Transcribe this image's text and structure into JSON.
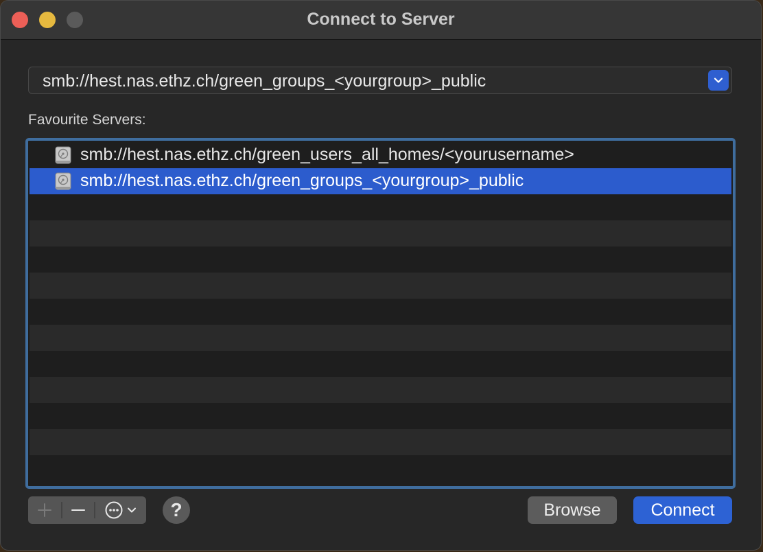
{
  "window": {
    "title": "Connect to Server"
  },
  "traffic_lights": {
    "close_color": "#ec5f57",
    "minimize_color": "#e6b93f",
    "zoom_color": "#5a5a5a"
  },
  "address": {
    "value": "smb://hest.nas.ethz.ch/green_groups_<yourgroup>_public",
    "toggle_icon": "chevron-down-icon"
  },
  "favourites": {
    "label": "Favourite Servers:",
    "items": [
      {
        "text": "smb://hest.nas.ethz.ch/green_users_all_homes/<yourusername>",
        "icon": "server-drive-icon",
        "selected": false
      },
      {
        "text": "smb://hest.nas.ethz.ch/green_groups_<yourgroup>_public",
        "icon": "server-drive-icon",
        "selected": true
      }
    ]
  },
  "toolbar": {
    "add_icon": "plus-icon",
    "remove_icon": "minus-icon",
    "more_icon": "ellipsis-circle-icon",
    "help_label": "?"
  },
  "buttons": {
    "browse_label": "Browse",
    "connect_label": "Connect"
  },
  "colors": {
    "accent": "#2d62d4",
    "selection": "#2c5ccd",
    "list_border": "#3f6d9e"
  }
}
